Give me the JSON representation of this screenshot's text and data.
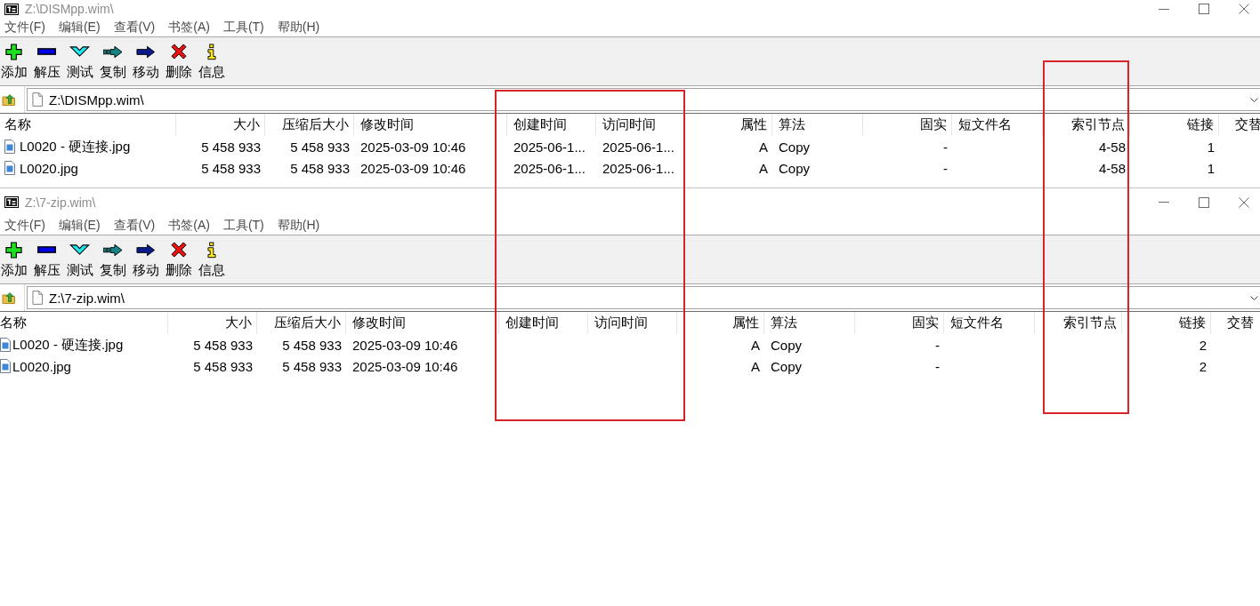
{
  "windows": [
    {
      "title": "Z:\\DISMpp.wim\\",
      "menu": [
        "文件(F)",
        "编辑(E)",
        "查看(V)",
        "书签(A)",
        "工具(T)",
        "帮助(H)"
      ],
      "toolbar": [
        {
          "kind": "add",
          "label": "添加"
        },
        {
          "kind": "extract",
          "label": "解压"
        },
        {
          "kind": "test",
          "label": "测试"
        },
        {
          "kind": "copy",
          "label": "复制"
        },
        {
          "kind": "move",
          "label": "移动"
        },
        {
          "kind": "delete",
          "label": "删除"
        },
        {
          "kind": "info",
          "label": "信息"
        }
      ],
      "address_bar": {
        "value": "Z:\\DISMpp.wim\\"
      },
      "columns": [
        "名称",
        "大小",
        "压缩后大小",
        "修改时间",
        "创建时间",
        "访问时间",
        "属性",
        "算法",
        "固实",
        "短文件名",
        "索引节点",
        "链接",
        "交替"
      ],
      "rows": [
        [
          "L0020 - 硬连接.jpg",
          "5 458 933",
          "5 458 933",
          "2025-03-09 10:46",
          "2025-06-1...",
          "2025-06-1...",
          "A",
          "Copy",
          "-",
          null,
          "4-58",
          "1"
        ],
        [
          "L0020.jpg",
          "5 458 933",
          "5 458 933",
          "2025-03-09 10:46",
          "2025-06-1...",
          "2025-06-1...",
          "A",
          "Copy",
          "-",
          null,
          "4-58",
          "1"
        ]
      ]
    },
    {
      "title": "Z:\\7-zip.wim\\",
      "menu": [
        "文件(F)",
        "编辑(E)",
        "查看(V)",
        "书签(A)",
        "工具(T)",
        "帮助(H)"
      ],
      "toolbar": [
        {
          "kind": "add",
          "label": "添加"
        },
        {
          "kind": "extract",
          "label": "解压"
        },
        {
          "kind": "test",
          "label": "测试"
        },
        {
          "kind": "copy",
          "label": "复制"
        },
        {
          "kind": "move",
          "label": "移动"
        },
        {
          "kind": "delete",
          "label": "删除"
        },
        {
          "kind": "info",
          "label": "信息"
        }
      ],
      "address_bar": {
        "value": "Z:\\7-zip.wim\\"
      },
      "columns": [
        "名称",
        "大小",
        "压缩后大小",
        "修改时间",
        "创建时间",
        "访问时间",
        "属性",
        "算法",
        "固实",
        "短文件名",
        "索引节点",
        "链接",
        "交替"
      ],
      "rows": [
        [
          "L0020 - 硬连接.jpg",
          "5 458 933",
          "5 458 933",
          "2025-03-09 10:46",
          null,
          null,
          "A",
          "Copy",
          "-",
          null,
          null,
          "2"
        ],
        [
          "L0020.jpg",
          "5 458 933",
          "5 458 933",
          "2025-03-09 10:46",
          null,
          null,
          "A",
          "Copy",
          "-",
          null,
          null,
          "2"
        ]
      ]
    }
  ],
  "annotations": [
    {
      "kind": "rectangle"
    },
    {
      "kind": "rectangle"
    }
  ]
}
